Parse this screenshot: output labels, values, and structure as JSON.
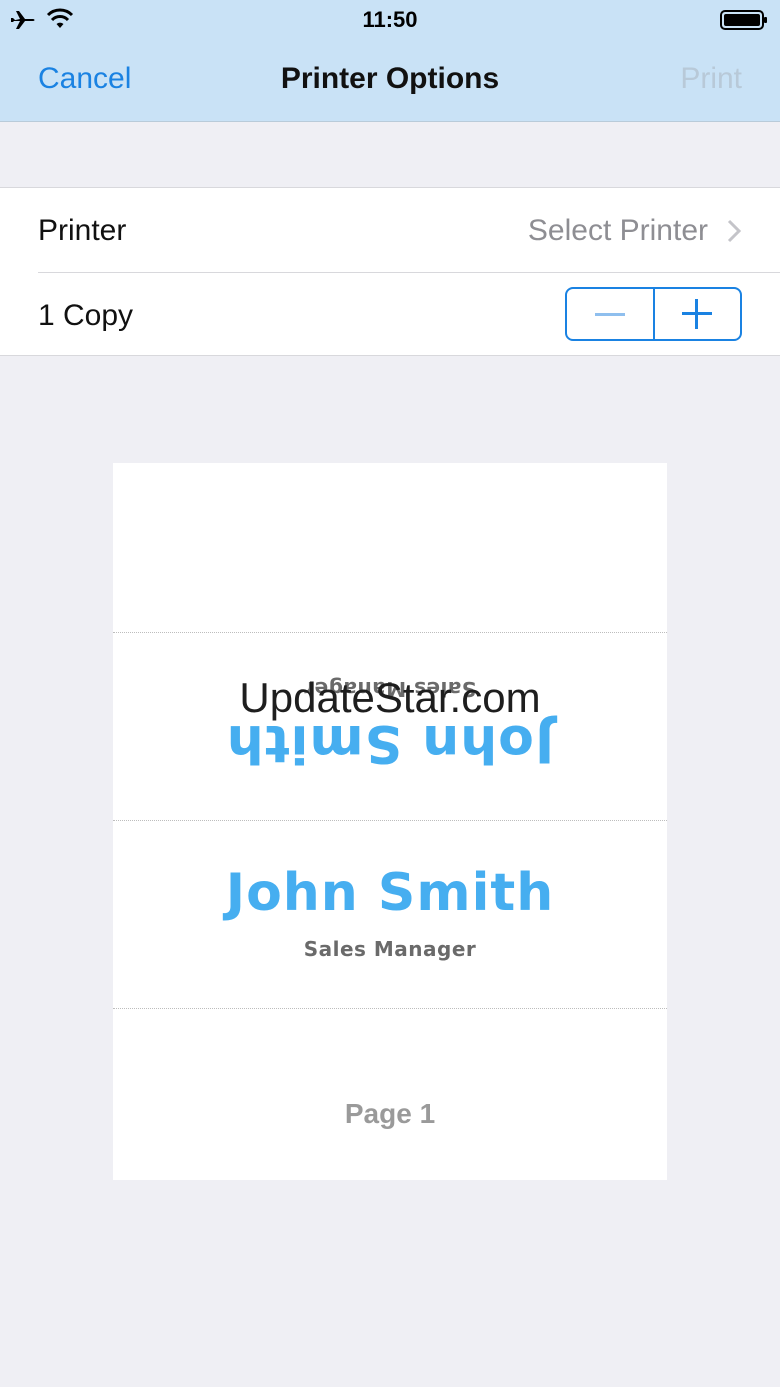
{
  "status_bar": {
    "time": "11:50",
    "icons": [
      "airplane-icon",
      "wifi-icon",
      "battery-icon"
    ]
  },
  "nav": {
    "cancel_label": "Cancel",
    "title": "Printer Options",
    "print_label": "Print"
  },
  "settings": {
    "printer_label": "Printer",
    "printer_value": "Select Printer",
    "copies_label": "1 Copy"
  },
  "preview": {
    "upside_down_name": "John Smith",
    "upside_down_role": "Sales Manager",
    "name": "John Smith",
    "role": "Sales Manager",
    "page_label": "Page 1"
  },
  "watermark": "UpdateStar.com",
  "colors": {
    "accent": "#1a82e2",
    "header_bg": "#c9e2f6",
    "name_blue": "#46aef0",
    "page_bg": "#efeff4"
  }
}
